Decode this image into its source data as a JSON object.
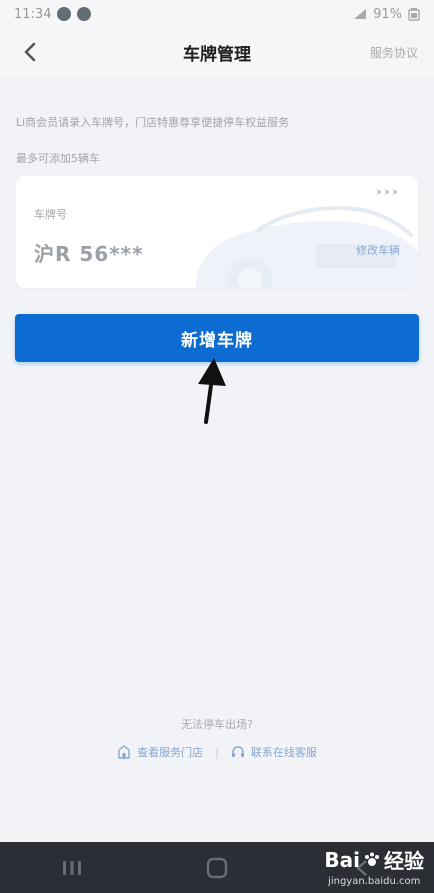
{
  "status": {
    "time": "11:34",
    "right": "91%"
  },
  "header": {
    "title": "车牌管理",
    "right": "服务协议"
  },
  "page": {
    "notice": "Li商会员请录入车牌号，门店特惠尊享便捷停车权益服务",
    "limit": "最多可添加5辆车"
  },
  "card": {
    "label": "车牌号",
    "plate": "沪R 56***",
    "edit": "修改车辆"
  },
  "primary": {
    "label": "新增车牌"
  },
  "help": {
    "question": "无法停车出场?",
    "link_store": "查看服务门店",
    "divider": "|",
    "link_service": "联系在线客服"
  },
  "watermark": {
    "logo_left": "Bai",
    "logo_right": "经验",
    "url": "jingyan.baidu.com"
  },
  "colors": {
    "primary": "#0d6cd1",
    "background": "#f2f3f6",
    "nav": "#2b2f35"
  }
}
